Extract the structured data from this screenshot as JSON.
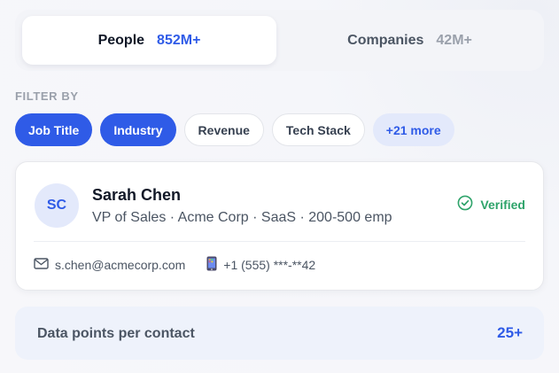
{
  "tabs": [
    {
      "label": "People",
      "count": "852M+"
    },
    {
      "label": "Companies",
      "count": "42M+"
    }
  ],
  "filter": {
    "heading": "FILTER BY",
    "chips": [
      "Job Title",
      "Industry",
      "Revenue",
      "Tech Stack",
      "+21 more"
    ],
    "selected": [
      "Job Title",
      "Industry"
    ]
  },
  "contact": {
    "initials": "SC",
    "name": "Sarah Chen",
    "subtitle": "VP of Sales · Acme Corp · SaaS · 200-500 emp",
    "status": "Verified",
    "email": "s.chen@acmecorp.com",
    "phone": "+1 (555) ***-**42"
  },
  "datapoints": {
    "label": "Data points per contact",
    "value": "25+"
  },
  "colors": {
    "accent": "#2f5be7",
    "verified": "#2ea36a",
    "chip_more_bg": "#e3e9fb"
  },
  "icons": {
    "status": "check-circle-icon",
    "email": "mail-icon",
    "phone": "mobile-phone-icon"
  }
}
